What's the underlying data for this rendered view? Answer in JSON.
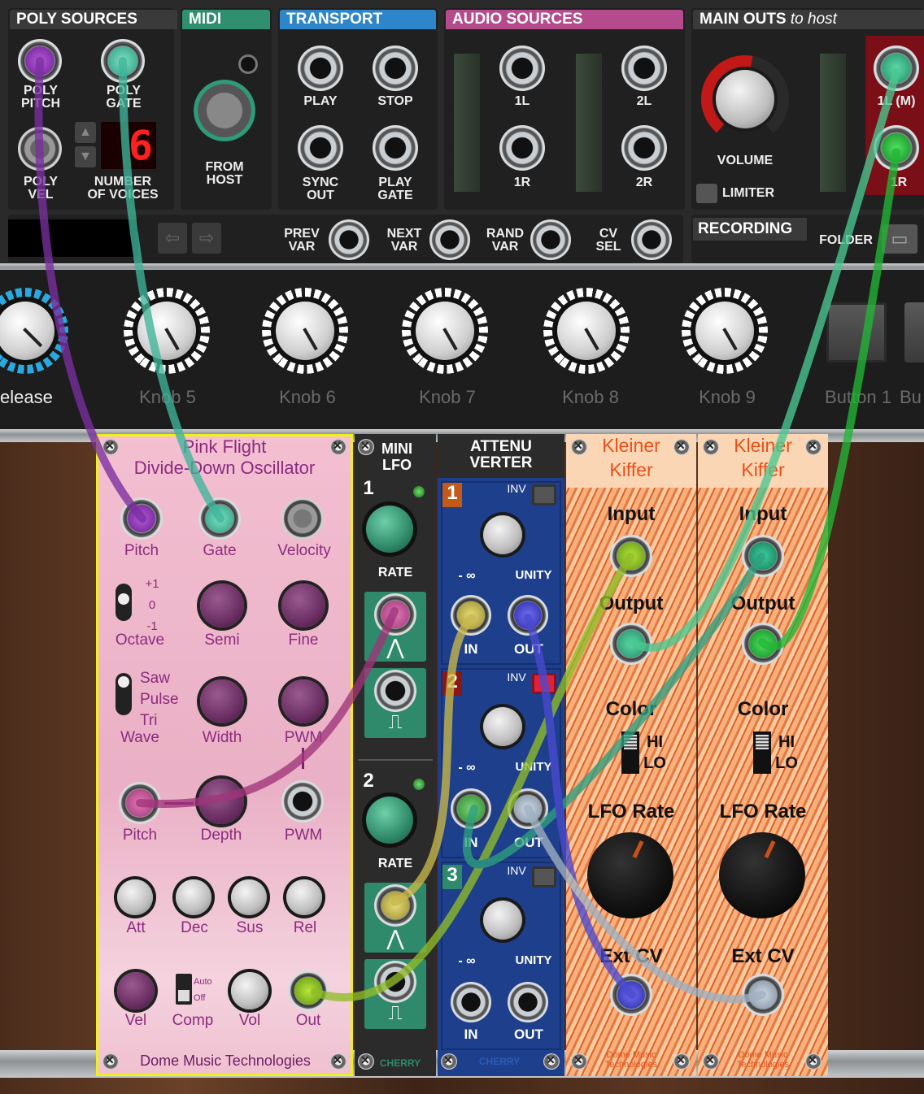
{
  "io": {
    "poly_sources": {
      "title": "POLY SOURCES",
      "pitch": "POLY\nPITCH",
      "gate": "POLY\nGATE",
      "vel": "POLY\nVEL",
      "voices_label": "NUMBER\nOF VOICES",
      "voices_value": "6"
    },
    "midi": {
      "title": "MIDI",
      "from_host": "FROM\nHOST"
    },
    "transport": {
      "title": "TRANSPORT",
      "play": "PLAY",
      "stop": "STOP",
      "sync_out": "SYNC\nOUT",
      "play_gate": "PLAY\nGATE"
    },
    "audio_sources": {
      "title": "AUDIO SOURCES",
      "l1": "1L",
      "l2": "2L",
      "r1": "1R",
      "r2": "2R"
    },
    "main_outs": {
      "title": "MAIN OUTS",
      "title_suffix": "to host",
      "volume": "VOLUME",
      "limiter": "LIMITER",
      "out_l": "1L (M)",
      "out_r": "1R"
    },
    "variations": {
      "prev": "PREV\nVAR",
      "next": "NEXT\nVAR",
      "rand": "RAND\nVAR",
      "cv": "CV\nSEL"
    },
    "recording": {
      "title": "RECORDING",
      "folder": "FOLDER"
    }
  },
  "knobs": {
    "release": "elease",
    "k5": "Knob 5",
    "k6": "Knob 6",
    "k7": "Knob 7",
    "k8": "Knob 8",
    "k9": "Knob 9",
    "b1": "Button 1",
    "b2": "Bu"
  },
  "pink_flight": {
    "title1": "Pink Flight",
    "title2": "Divide-Down Oscillator",
    "pitch": "Pitch",
    "gate": "Gate",
    "velocity": "Velocity",
    "oct_p1": "+1",
    "oct_0": "0",
    "oct_m1": "-1",
    "octave": "Octave",
    "semi": "Semi",
    "fine": "Fine",
    "saw": "Saw",
    "pulse": "Pulse",
    "tri": "Tri",
    "wave": "Wave",
    "width": "Width",
    "pwm": "PWM",
    "pitch2": "Pitch",
    "depth": "Depth",
    "pwm2": "PWM",
    "att": "Att",
    "dec": "Dec",
    "sus": "Sus",
    "rel": "Rel",
    "vel": "Vel",
    "comp_auto": "Auto",
    "comp_off": "Off",
    "comp": "Comp",
    "vol": "Vol",
    "out": "Out",
    "maker": "Dome Music Technologies"
  },
  "mini_lfo": {
    "title": "MINI\nLFO",
    "ch1": "1",
    "rate1": "RATE",
    "ch2": "2",
    "rate2": "RATE",
    "maker": "CHERRY"
  },
  "attenuverter": {
    "title": "ATTENU\nVERTER",
    "ch1": "1",
    "ch2": "2",
    "ch3": "3",
    "inv": "INV",
    "minus_inf": "- ∞",
    "unity": "UNITY",
    "in": "IN",
    "out": "OUT",
    "maker": "CHERRY"
  },
  "kleiner": {
    "title1": "Kleiner",
    "title2": "Kiffer",
    "input": "Input",
    "output": "Output",
    "color": "Color",
    "hi": "HI",
    "lo": "LO",
    "lfo_rate": "LFO Rate",
    "ext_cv": "Ext CV",
    "maker": "Dome Music\nTechnologies"
  },
  "colors": {
    "pink": "#f0b8cc",
    "blue": "#1e3f8c",
    "orange": "#f3a070",
    "purple": "#7a2fa0",
    "teal": "#3fb59a",
    "green": "#1fae3b",
    "yellow": "#c9b84a"
  }
}
